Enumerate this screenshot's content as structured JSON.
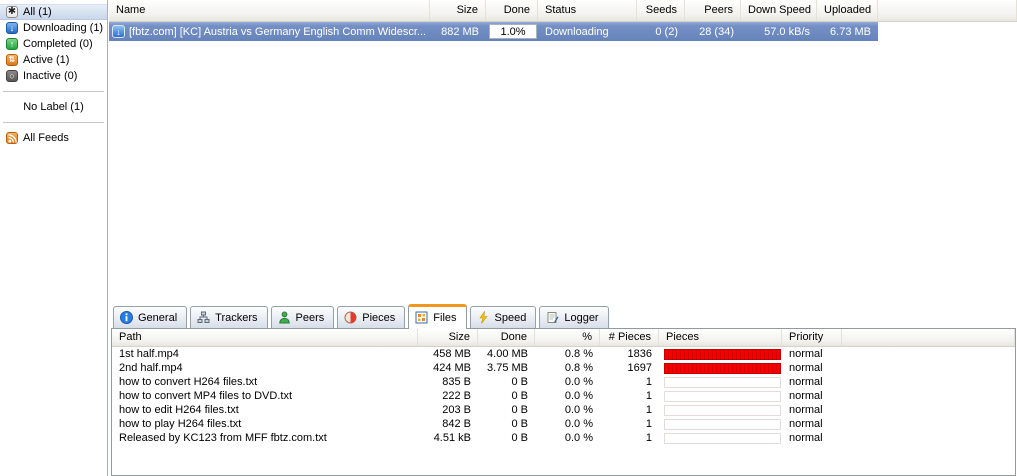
{
  "sidebar": {
    "items": [
      {
        "label": "All (1)",
        "icon": "asterisk-icon",
        "glyph": "✱",
        "selected": true
      },
      {
        "label": "Downloading (1)",
        "icon": "download-arrow-icon",
        "glyph": "↓",
        "selected": false
      },
      {
        "label": "Completed (0)",
        "icon": "upload-arrow-icon",
        "glyph": "↑",
        "selected": false
      },
      {
        "label": "Active (1)",
        "icon": "active-arrows-icon",
        "glyph": "⇅",
        "selected": false
      },
      {
        "label": "Inactive (0)",
        "icon": "inactive-dot-icon",
        "glyph": "○",
        "selected": false
      }
    ],
    "no_label": "No Label (1)",
    "all_feeds": "All Feeds"
  },
  "torrent_list": {
    "columns": {
      "name": "Name",
      "size": "Size",
      "done": "Done",
      "status": "Status",
      "seeds": "Seeds",
      "peers": "Peers",
      "down_speed": "Down Speed",
      "uploaded": "Uploaded"
    },
    "row": {
      "name": "[fbtz.com] [KC] Austria vs Germany English Comm Widescr...",
      "size": "882 MB",
      "done": "1.0%",
      "status": "Downloading",
      "seeds": "0 (2)",
      "peers": "28 (34)",
      "down_speed": "57.0 kB/s",
      "uploaded": "6.73 MB"
    }
  },
  "tabs": {
    "general": "General",
    "trackers": "Trackers",
    "peers": "Peers",
    "pieces": "Pieces",
    "files": "Files",
    "speed": "Speed",
    "logger": "Logger",
    "active_tab": "Files"
  },
  "files_tab": {
    "columns": {
      "path": "Path",
      "size": "Size",
      "done": "Done",
      "percent": "%",
      "num_pieces": "# Pieces",
      "pieces": "Pieces",
      "priority": "Priority"
    },
    "rows": [
      {
        "path": "1st half.mp4",
        "size": "458 MB",
        "done": "4.00 MB",
        "percent": "0.8 %",
        "num_pieces": "1836",
        "pieces_fill": 100,
        "priority": "normal"
      },
      {
        "path": "2nd half.mp4",
        "size": "424 MB",
        "done": "3.75 MB",
        "percent": "0.8 %",
        "num_pieces": "1697",
        "pieces_fill": 100,
        "priority": "normal"
      },
      {
        "path": "how to convert H264 files.txt",
        "size": "835 B",
        "done": "0 B",
        "percent": "0.0 %",
        "num_pieces": "1",
        "pieces_fill": 0,
        "priority": "normal"
      },
      {
        "path": "how to convert MP4 files to DVD.txt",
        "size": "222 B",
        "done": "0 B",
        "percent": "0.0 %",
        "num_pieces": "1",
        "pieces_fill": 0,
        "priority": "normal"
      },
      {
        "path": "how to edit H264 files.txt",
        "size": "203 B",
        "done": "0 B",
        "percent": "0.0 %",
        "num_pieces": "1",
        "pieces_fill": 0,
        "priority": "normal"
      },
      {
        "path": "how to play H264 files.txt",
        "size": "842 B",
        "done": "0 B",
        "percent": "0.0 %",
        "num_pieces": "1",
        "pieces_fill": 0,
        "priority": "normal"
      },
      {
        "path": "Released by KC123 from MFF fbtz.com.txt",
        "size": "4.51 kB",
        "done": "0 B",
        "percent": "0.0 %",
        "num_pieces": "1",
        "pieces_fill": 0,
        "priority": "normal"
      }
    ]
  },
  "colors": {
    "selection_blue": "#6583bb",
    "pieces_red": "#f40000",
    "active_tab_orange": "#f0981e",
    "sidebar_selected": "#c9d7ec"
  }
}
